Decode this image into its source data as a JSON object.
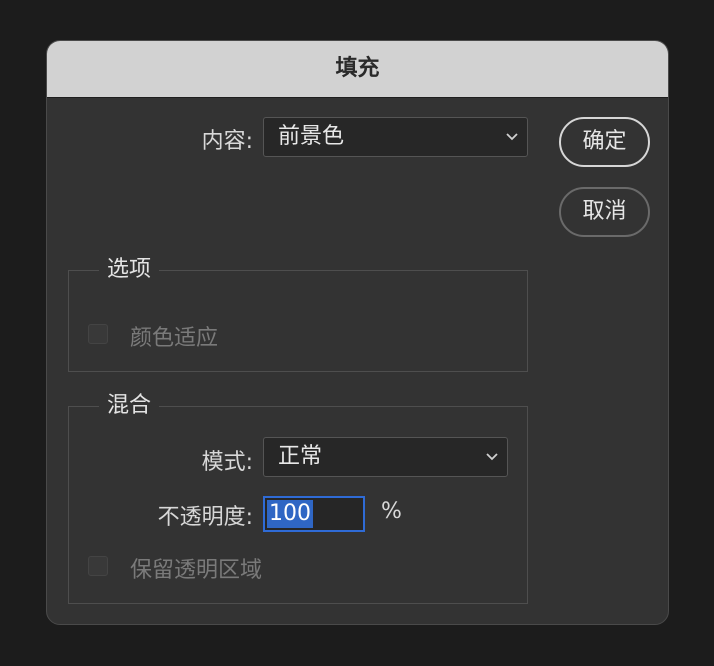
{
  "dialog": {
    "title": "填充",
    "content_label": "内容:",
    "content_value": "前景色",
    "ok_label": "确定",
    "cancel_label": "取消"
  },
  "options": {
    "title": "选项",
    "color_adapt_label": "颜色适应",
    "color_adapt_checked": false
  },
  "blend": {
    "title": "混合",
    "mode_label": "模式:",
    "mode_value": "正常",
    "opacity_label": "不透明度:",
    "opacity_value": "100",
    "opacity_unit": "%",
    "preserve_transparency_label": "保留透明区域",
    "preserve_transparency_checked": false
  },
  "colors": {
    "accent": "#2f6bd6",
    "titlebar": "#d2d2d2",
    "panel": "#333333"
  },
  "icons": {
    "dropdown": "chevron-down-icon"
  }
}
